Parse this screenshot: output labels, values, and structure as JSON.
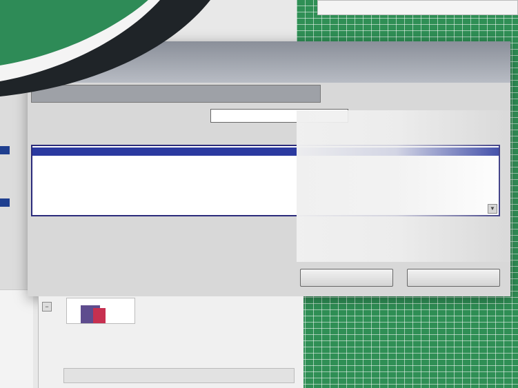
{
  "top_strip": {
    "text": ""
  },
  "dialog": {
    "title": "",
    "description": "",
    "category_label": "",
    "category_value": "",
    "function_label": "",
    "functions": [
      {
        "label": "",
        "selected": true
      },
      {
        "label": "",
        "selected": false
      },
      {
        "label": "",
        "selected": false
      },
      {
        "label": "",
        "selected": false
      },
      {
        "label": "",
        "selected": false
      },
      {
        "label": "",
        "selected": false
      },
      {
        "label": "",
        "selected": false
      }
    ],
    "syntax": "",
    "syntax_description": "",
    "help_link": "",
    "ok_label": "",
    "cancel_label": ""
  },
  "lower_panel": {
    "description": "",
    "button_label": ""
  },
  "colors": {
    "matrix_green": "#2f8f55",
    "swoosh_green": "#2e8b57",
    "selection_blue": "#2b3aa0"
  }
}
